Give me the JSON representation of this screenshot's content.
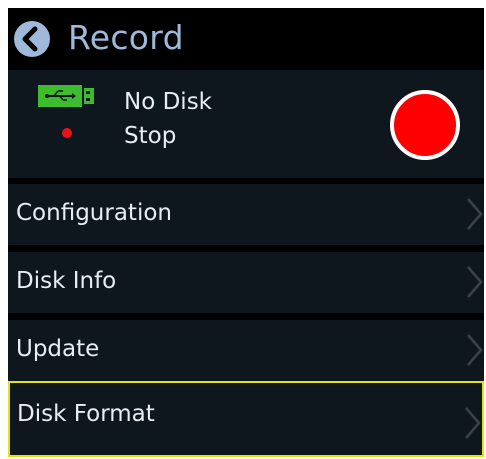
{
  "header": {
    "title": "Record",
    "back_icon": "chevron-left-circle-icon"
  },
  "status": {
    "disk_label": "No Disk",
    "record_label": "Stop",
    "usb_icon": "usb-icon",
    "usb_color": "#3dbd2e",
    "record_color": "#ff0000"
  },
  "menu": {
    "items": [
      {
        "label": "Configuration",
        "selected": false
      },
      {
        "label": "Disk Info",
        "selected": false
      },
      {
        "label": "Update",
        "selected": false
      },
      {
        "label": "Disk Format",
        "selected": true
      }
    ]
  },
  "colors": {
    "accent": "#9fb9db",
    "panel": "#0f171e",
    "selection": "#e5e20e"
  }
}
